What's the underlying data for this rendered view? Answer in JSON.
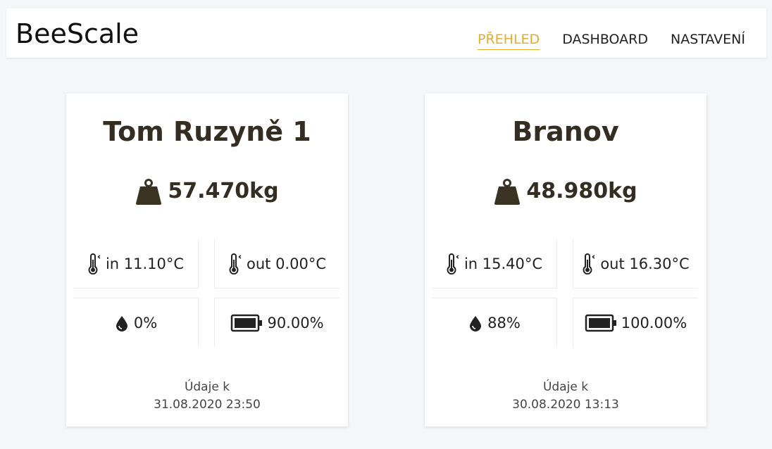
{
  "app": {
    "title": "BeeScale"
  },
  "nav": {
    "items": [
      {
        "label": "PŘEHLED",
        "active": true
      },
      {
        "label": "DASHBOARD",
        "active": false
      },
      {
        "label": "NASTAVENÍ",
        "active": false
      }
    ]
  },
  "colors": {
    "accent": "#e5ad2d",
    "icon": "#3a3324",
    "text": "#332d22"
  },
  "cards": [
    {
      "name": "Tom Ruzyně 1",
      "weight": "57.470kg",
      "temp_in": "in 11.10°C",
      "temp_out": "out 0.00°C",
      "humidity": "0%",
      "battery": "90.00%",
      "updated_label": "Údaje k",
      "updated_at": "31.08.2020 23:50"
    },
    {
      "name": "Branov",
      "weight": "48.980kg",
      "temp_in": "in 15.40°C",
      "temp_out": "out 16.30°C",
      "humidity": "88%",
      "battery": "100.00%",
      "updated_label": "Údaje k",
      "updated_at": "30.08.2020 13:13"
    }
  ],
  "icons": [
    "weight-icon",
    "thermometer-icon",
    "water-drop-icon",
    "battery-icon"
  ]
}
